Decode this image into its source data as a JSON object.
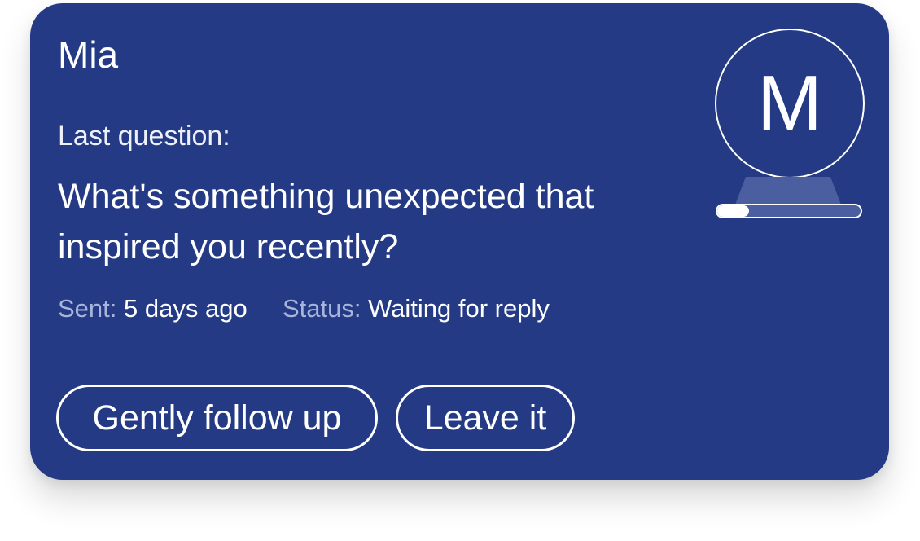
{
  "card": {
    "name": "Mia",
    "last_question_label": "Last question:",
    "question": "What's something unexpected that inspired you recently?",
    "sent_label": "Sent:",
    "sent_value": "5 days ago",
    "status_label": "Status:",
    "status_value": "Waiting for reply"
  },
  "avatar": {
    "initial": "M",
    "progress_fraction": 0.22
  },
  "actions": {
    "follow_up_label": "Gently follow up",
    "leave_label": "Leave it"
  },
  "colors": {
    "card_background": "#243a84",
    "text": "#ffffff",
    "muted_text": "#a9b4dc"
  }
}
